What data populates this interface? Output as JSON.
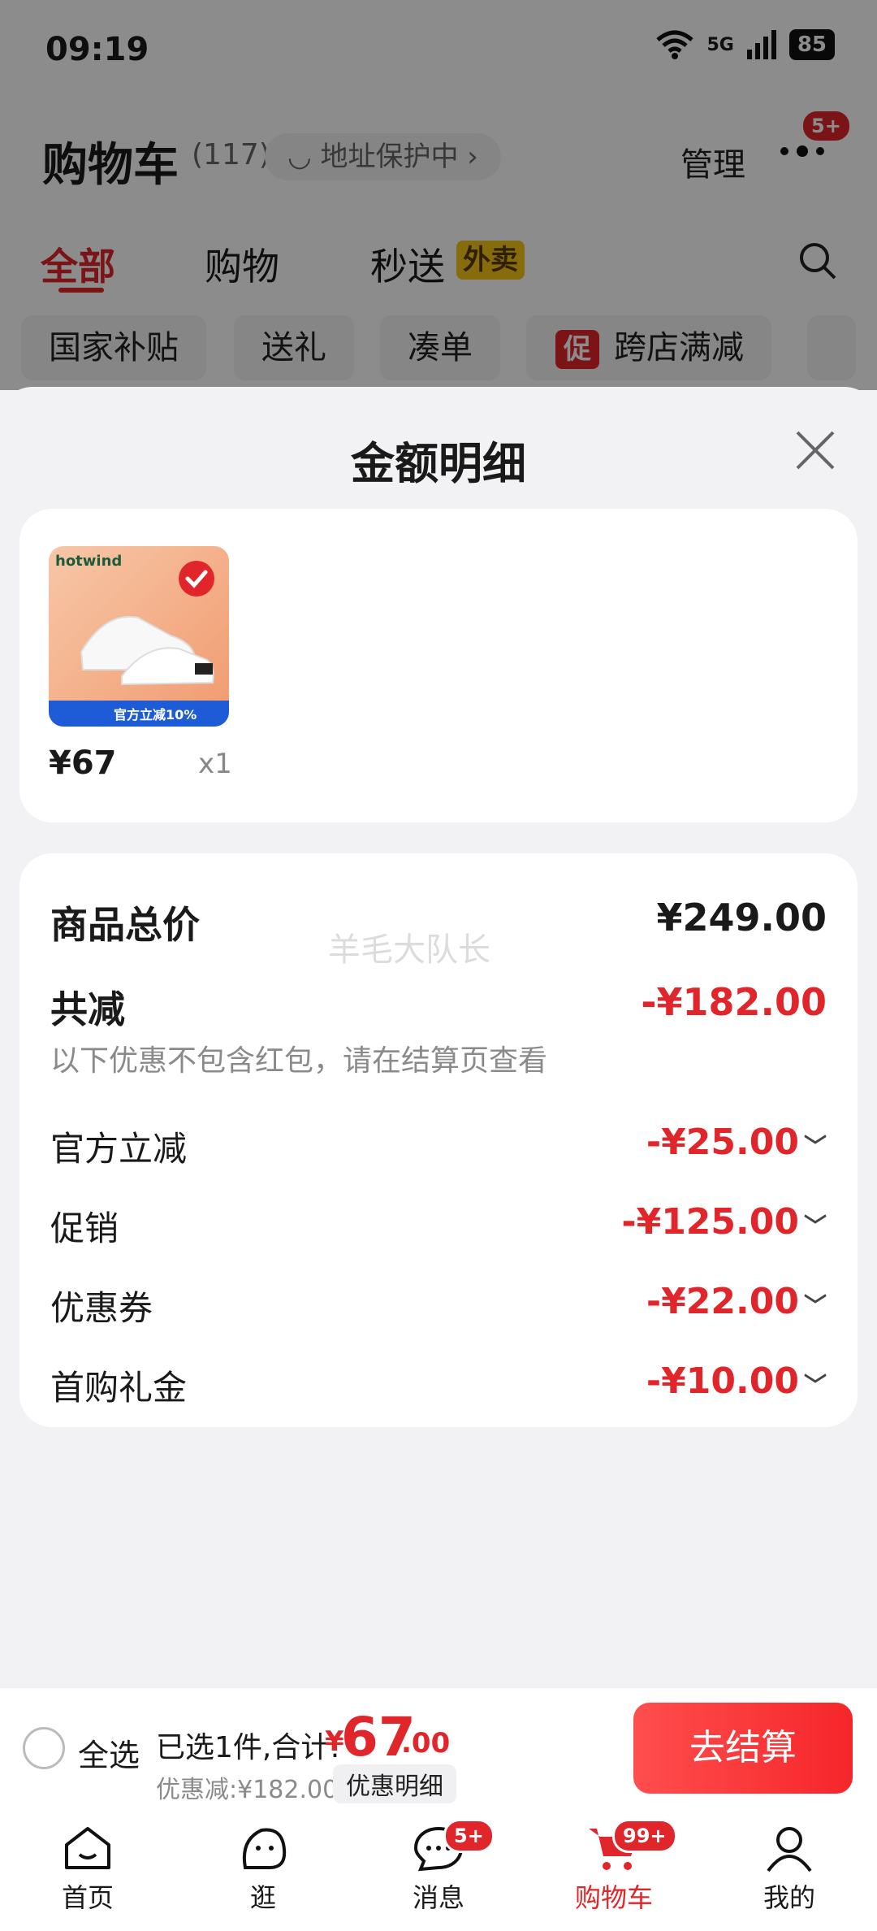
{
  "status_bar": {
    "time": "09:19",
    "network": "5G",
    "battery": "85"
  },
  "header": {
    "title": "购物车",
    "count": "(117)",
    "address_protect": "地址保护中",
    "manage": "管理",
    "more_badge": "5+"
  },
  "tabs": [
    {
      "label": "全部"
    },
    {
      "label": "购物"
    },
    {
      "label": "秒送"
    }
  ],
  "tab_tag": "外卖",
  "chips": [
    {
      "label": "国家补贴"
    },
    {
      "label": "送礼"
    },
    {
      "label": "凑单"
    },
    {
      "label": "跨店满减"
    }
  ],
  "chip_tag": "促",
  "sheet": {
    "title": "金额明细",
    "item": {
      "brand": "hotwind",
      "price": "¥67",
      "qty": "x1",
      "promo": "官方立减10%"
    },
    "watermark": "羊毛大队长",
    "total_label": "商品总价",
    "total_value": "¥249.00",
    "reduce_label": "共减",
    "reduce_value": "-¥182.00",
    "reduce_note": "以下优惠不包含红包，请在结算页查看",
    "lines": [
      {
        "label": "官方立减",
        "value": "-¥25.00"
      },
      {
        "label": "促销",
        "value": "-¥125.00"
      },
      {
        "label": "优惠券",
        "value": "-¥22.00"
      },
      {
        "label": "首购礼金",
        "value": "-¥10.00"
      }
    ]
  },
  "checkout": {
    "select_all": "全选",
    "summary": "已选1件,合计:",
    "currency": "¥",
    "total_int": "67",
    "total_dec": ".00",
    "discount": "优惠减:¥182.00",
    "detail": "优惠明细",
    "pay": "去结算"
  },
  "nav": [
    {
      "label": "首页",
      "badge": ""
    },
    {
      "label": "逛",
      "badge": ""
    },
    {
      "label": "消息",
      "badge": "5+"
    },
    {
      "label": "购物车",
      "badge": "99+"
    },
    {
      "label": "我的",
      "badge": ""
    }
  ],
  "colors": {
    "accent": "#e0262b",
    "sheet_bg": "#f2f2f4"
  }
}
